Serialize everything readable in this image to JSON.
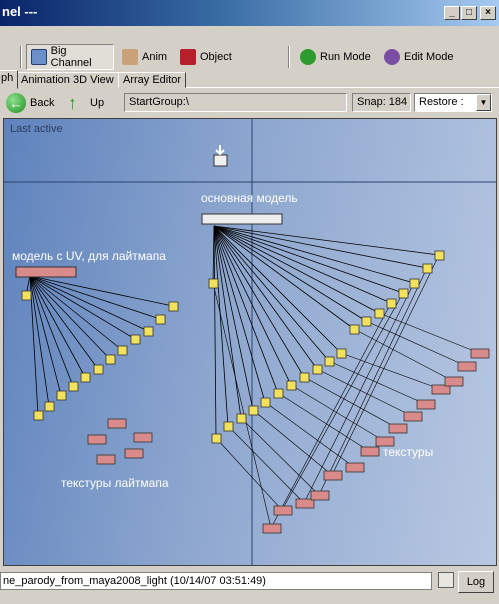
{
  "window": {
    "title": "nel ---",
    "minimize": "_",
    "maximize": "□",
    "close": "×"
  },
  "toolbar": {
    "big_channel": "Big Channel",
    "anim": "Anim",
    "object": "Object",
    "run_mode": "Run Mode",
    "edit_mode": "Edit Mode"
  },
  "tabs": [
    "ph",
    "Animation 3D View",
    "Array Editor"
  ],
  "nav": {
    "back": "Back",
    "up": "Up",
    "path": "StartGroup:\\",
    "snap": "Snap: 184",
    "restore": "Restore :"
  },
  "graph": {
    "last_active": "Last active",
    "label_main_model": "основная модель",
    "label_uv_model": "модель с UV, для лайтмапа",
    "label_textures": "текстуры",
    "label_lightmap_textures": "текстуры лайтмапа"
  },
  "status": {
    "text": "ne_parody_from_maya2008_light (10/14/07 03:51:49)",
    "log": "Log"
  },
  "colors": {
    "node_pink": "#d98a8a",
    "node_yellow": "#f2e15c",
    "canvas_left": "#5f83bd",
    "canvas_right": "#b8c8e2"
  }
}
